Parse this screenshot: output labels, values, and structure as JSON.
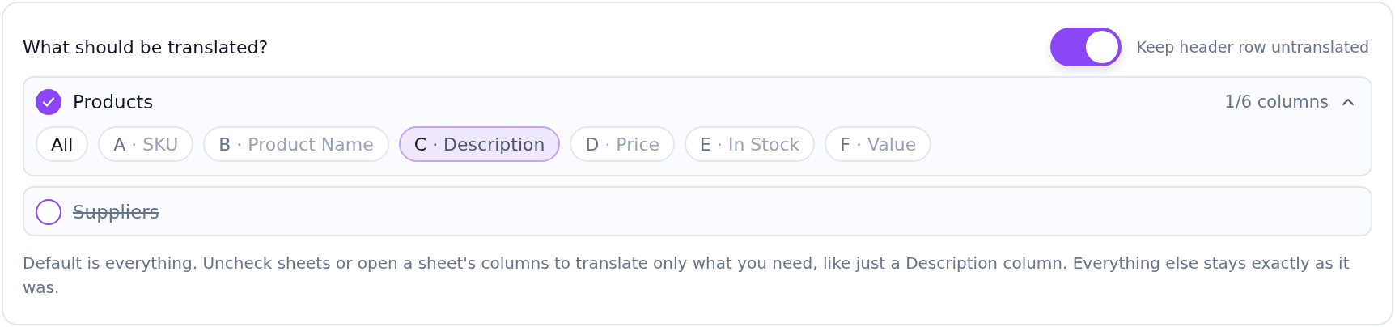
{
  "title": "What should be translated?",
  "header_toggle": {
    "label": "Keep header row untranslated",
    "on": true
  },
  "sheets": [
    {
      "name": "Products",
      "checked": true,
      "expanded": true,
      "count": "1/6 columns",
      "columns": [
        {
          "kind": "all",
          "letter": "All",
          "selected": false
        },
        {
          "kind": "column",
          "letter": "A",
          "name": "· SKU",
          "selected": false
        },
        {
          "kind": "column",
          "letter": "B",
          "name": "· Product Name",
          "selected": false
        },
        {
          "kind": "column",
          "letter": "C",
          "name": "· Description",
          "selected": true
        },
        {
          "kind": "column",
          "letter": "D",
          "name": "· Price",
          "selected": false
        },
        {
          "kind": "column",
          "letter": "E",
          "name": "· In Stock",
          "selected": false
        },
        {
          "kind": "column",
          "letter": "F",
          "name": "· Value",
          "selected": false
        }
      ]
    },
    {
      "name": "Suppliers",
      "checked": false
    }
  ],
  "help": "Default is everything. Uncheck sheets or open a sheet's columns to translate only what you need, like just a Description column. Everything else stays exactly as it was."
}
